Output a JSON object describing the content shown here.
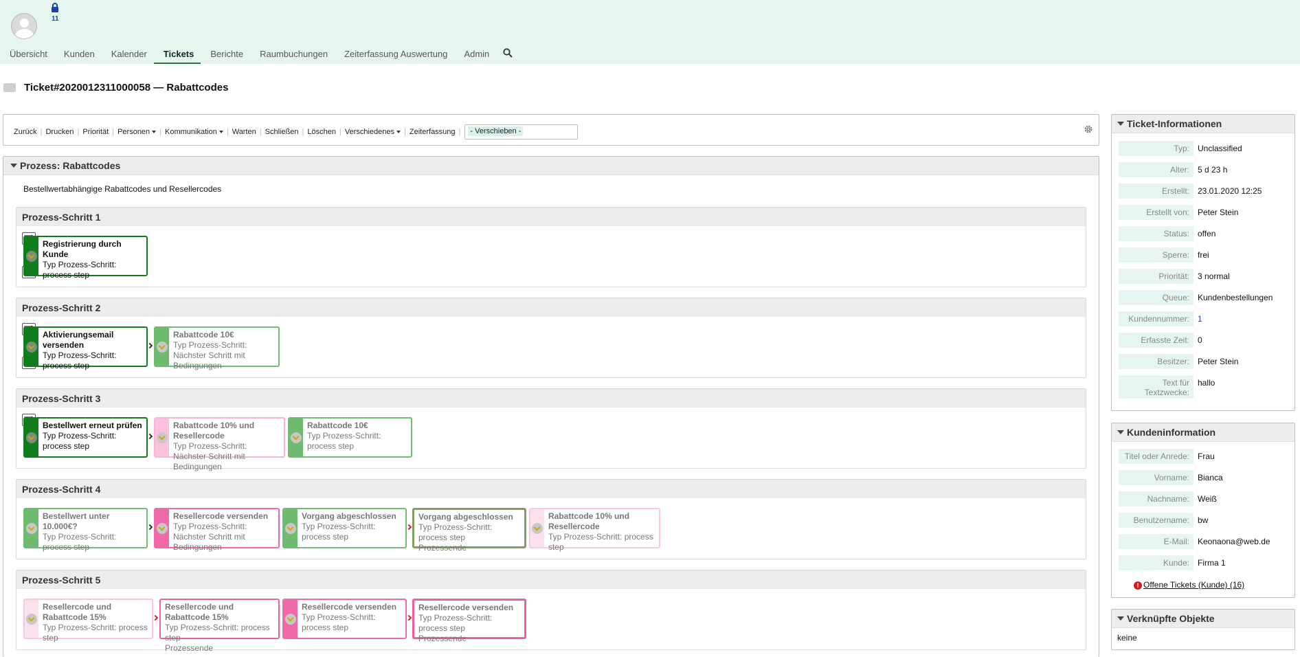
{
  "header": {
    "lock_count": "11",
    "nav": [
      "Übersicht",
      "Kunden",
      "Kalender",
      "Tickets",
      "Berichte",
      "Raumbuchungen",
      "Zeiterfassung Auswertung",
      "Admin"
    ],
    "active_nav": "Tickets"
  },
  "ticket": {
    "title": "Ticket#2020012311000058 — Rabattcodes"
  },
  "toolbar": {
    "back": "Zurück",
    "print": "Drucken",
    "priority": "Priorität",
    "people": "Personen",
    "communication": "Kommunikation",
    "pending": "Warten",
    "close": "Schließen",
    "delete": "Löschen",
    "misc": "Verschiedenes",
    "time": "Zeiterfassung",
    "move_value": "- Verschieben -"
  },
  "process": {
    "header": "Prozess: Rabattcodes",
    "description": "Bestellwertabhängige Rabattcodes und Resellercodes",
    "steps": [
      {
        "title": "Prozess-Schritt 1",
        "boxes": [
          {
            "name": "Registrierung durch Kunde",
            "l1": "Typ Prozess-Schritt: process step",
            "l2": ""
          }
        ]
      },
      {
        "title": "Prozess-Schritt 2",
        "boxes": [
          {
            "name": "Aktivierungsemail versenden",
            "l1": "Typ Prozess-Schritt: process step",
            "l2": ""
          },
          {
            "name": "Rabattcode 10€",
            "l1": "Typ Prozess-Schritt:",
            "l2": "Nächster Schritt mit Bedingungen"
          }
        ]
      },
      {
        "title": "Prozess-Schritt 3",
        "boxes": [
          {
            "name": "Bestellwert erneut prüfen",
            "l1": "Typ Prozess-Schritt: process step",
            "l2": ""
          },
          {
            "name": "Rabattcode 10% und Resellercode",
            "l1": "Typ Prozess-Schritt:",
            "l2": "Nächster Schritt mit Bedingungen"
          },
          {
            "name": "Rabattcode 10€",
            "l1": "Typ Prozess-Schritt: process step",
            "l2": ""
          }
        ]
      },
      {
        "title": "Prozess-Schritt 4",
        "boxes": [
          {
            "name": "Bestellwert unter 10.000€?",
            "l1": "Typ Prozess-Schritt: process step",
            "l2": ""
          },
          {
            "name": "Resellercode versenden",
            "l1": "Typ Prozess-Schritt:",
            "l2": "Nächster Schritt mit Bedingungen"
          },
          {
            "name": "Vorgang abgeschlossen",
            "l1": "Typ Prozess-Schritt: process step",
            "l2": ""
          },
          {
            "name": "Vorgang abgeschlossen",
            "l1": "Typ Prozess-Schritt: process step",
            "l2": "Prozessende"
          },
          {
            "name": "Rabattcode 10% und Resellercode",
            "l1": "Typ Prozess-Schritt: process step",
            "l2": ""
          }
        ]
      },
      {
        "title": "Prozess-Schritt 5",
        "boxes": [
          {
            "name": "Resellercode und Rabattcode 15%",
            "l1": "Typ Prozess-Schritt: process step",
            "l2": ""
          },
          {
            "name": "Resellercode und Rabattcode 15%",
            "l1": "Typ Prozess-Schritt: process step",
            "l2": "Prozessende"
          },
          {
            "name": "Resellercode versenden",
            "l1": "Typ Prozess-Schritt: process step",
            "l2": ""
          },
          {
            "name": "Resellercode versenden",
            "l1": "Typ Prozess-Schritt: process step",
            "l2": "Prozessende"
          }
        ]
      }
    ]
  },
  "ticket_info": {
    "header": "Ticket-Informationen",
    "rows": [
      {
        "k": "Typ:",
        "v": "Unclassified"
      },
      {
        "k": "Alter:",
        "v": "5 d 23 h"
      },
      {
        "k": "Erstellt:",
        "v": "23.01.2020 12:25"
      },
      {
        "k": "Erstellt von:",
        "v": "Peter Stein"
      },
      {
        "k": "Status:",
        "v": "offen"
      },
      {
        "k": "Sperre:",
        "v": "frei"
      },
      {
        "k": "Priorität:",
        "v": "3 normal"
      },
      {
        "k": "Queue:",
        "v": "Kundenbestellungen"
      },
      {
        "k": "Kundennummer:",
        "v": "1"
      },
      {
        "k": "Erfasste Zeit:",
        "v": "0"
      },
      {
        "k": "Besitzer:",
        "v": "Peter Stein"
      },
      {
        "k": "Text für Textzwecke:",
        "v": "hallo"
      }
    ]
  },
  "customer_info": {
    "header": "Kundeninformation",
    "rows": [
      {
        "k": "Titel oder Anrede:",
        "v": "Frau"
      },
      {
        "k": "Vorname:",
        "v": "Bianca"
      },
      {
        "k": "Nachname:",
        "v": "Weiß"
      },
      {
        "k": "Benutzername:",
        "v": "bw"
      },
      {
        "k": "E-Mail:",
        "v": "Keonaona@web.de"
      },
      {
        "k": "Kunde:",
        "v": "Firma 1"
      }
    ],
    "open_tickets": "Offene Tickets (Kunde) (16)"
  },
  "linked": {
    "header": "Verknüpfte Objekte",
    "none": "keine"
  },
  "colors": {
    "header_bg": "#e6f6ee",
    "green_strong": "#0f7d1c",
    "green_light": "#6fbb6f",
    "pink_strong": "#f06aa9",
    "pink_light": "#fbc0dc"
  }
}
